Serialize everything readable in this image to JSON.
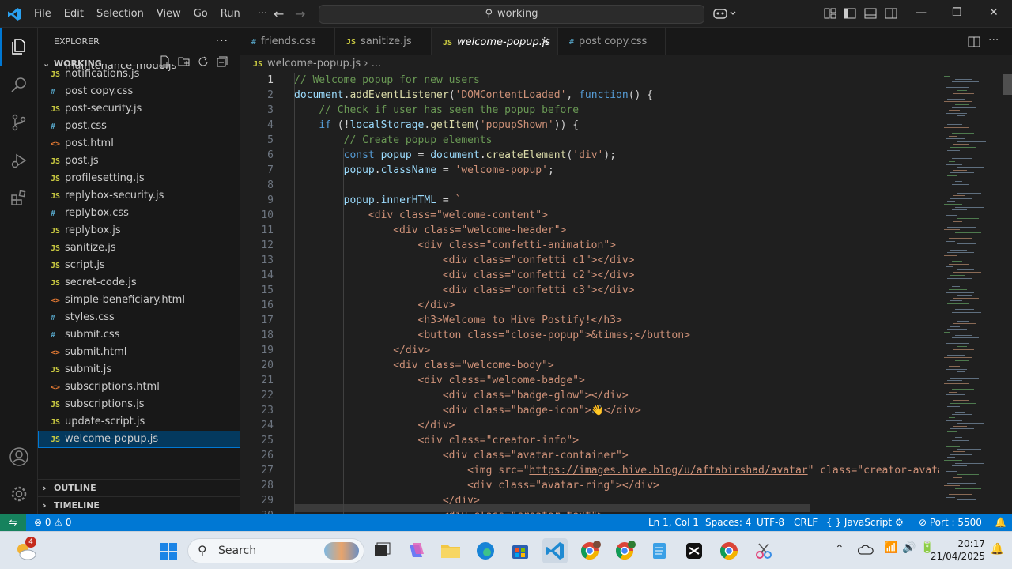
{
  "titlebar": {
    "menu": [
      "File",
      "Edit",
      "Selection",
      "View",
      "Go",
      "Run",
      "···"
    ],
    "search_text": "working",
    "colors": {
      "accent": "#0078d4",
      "background": "#1f1f1f"
    }
  },
  "activitybar": {
    "icons": [
      "explorer-icon",
      "search-icon",
      "source-control-icon",
      "run-debug-icon",
      "extensions-icon",
      "accounts-icon",
      "manage-gear-icon"
    ]
  },
  "sidebar": {
    "title": "EXPLORER",
    "folder": "WORKING",
    "partial_item": "maintenance-mode.js",
    "files": [
      {
        "name": "notifications.js",
        "type": "js"
      },
      {
        "name": "post copy.css",
        "type": "css"
      },
      {
        "name": "post-security.js",
        "type": "js"
      },
      {
        "name": "post.css",
        "type": "css"
      },
      {
        "name": "post.html",
        "type": "html"
      },
      {
        "name": "post.js",
        "type": "js"
      },
      {
        "name": "profilesetting.js",
        "type": "js"
      },
      {
        "name": "replybox-security.js",
        "type": "js"
      },
      {
        "name": "replybox.css",
        "type": "css"
      },
      {
        "name": "replybox.js",
        "type": "js"
      },
      {
        "name": "sanitize.js",
        "type": "js"
      },
      {
        "name": "script.js",
        "type": "js"
      },
      {
        "name": "secret-code.js",
        "type": "js"
      },
      {
        "name": "simple-beneficiary.html",
        "type": "html"
      },
      {
        "name": "styles.css",
        "type": "css"
      },
      {
        "name": "submit.css",
        "type": "css"
      },
      {
        "name": "submit.html",
        "type": "html"
      },
      {
        "name": "submit.js",
        "type": "js"
      },
      {
        "name": "subscriptions.html",
        "type": "html"
      },
      {
        "name": "subscriptions.js",
        "type": "js"
      },
      {
        "name": "update-script.js",
        "type": "js"
      },
      {
        "name": "welcome-popup.js",
        "type": "js",
        "selected": true
      }
    ],
    "outline": "OUTLINE",
    "timeline": "TIMELINE"
  },
  "tabs": [
    {
      "label": "friends.css",
      "type": "css",
      "icon": "#"
    },
    {
      "label": "sanitize.js",
      "type": "js",
      "icon": "JS"
    },
    {
      "label": "welcome-popup.js",
      "type": "js",
      "icon": "JS",
      "active": true
    },
    {
      "label": "post copy.css",
      "type": "css",
      "icon": "#"
    }
  ],
  "breadcrumb": {
    "file": "welcome-popup.js",
    "rest": "› ..."
  },
  "code_lines": [
    [
      [
        "c",
        "// Welcome popup for new users"
      ]
    ],
    [
      [
        "v",
        "document"
      ],
      [
        "p",
        "."
      ],
      [
        "f",
        "addEventListener"
      ],
      [
        "p",
        "("
      ],
      [
        "s",
        "'DOMContentLoaded'"
      ],
      [
        "p",
        ", "
      ],
      [
        "k",
        "function"
      ],
      [
        "p",
        "() {"
      ]
    ],
    [
      [
        "p",
        "    "
      ],
      [
        "c",
        "// Check if user has seen the popup before"
      ]
    ],
    [
      [
        "p",
        "    "
      ],
      [
        "k",
        "if"
      ],
      [
        "p",
        " (!"
      ],
      [
        "v",
        "localStorage"
      ],
      [
        "p",
        "."
      ],
      [
        "f",
        "getItem"
      ],
      [
        "p",
        "("
      ],
      [
        "s",
        "'popupShown'"
      ],
      [
        "p",
        ")) {"
      ]
    ],
    [
      [
        "p",
        "        "
      ],
      [
        "c",
        "// Create popup elements"
      ]
    ],
    [
      [
        "p",
        "        "
      ],
      [
        "k",
        "const"
      ],
      [
        "p",
        " "
      ],
      [
        "v",
        "popup"
      ],
      [
        "p",
        " = "
      ],
      [
        "v",
        "document"
      ],
      [
        "p",
        "."
      ],
      [
        "f",
        "createElement"
      ],
      [
        "p",
        "("
      ],
      [
        "s",
        "'div'"
      ],
      [
        "p",
        ");"
      ]
    ],
    [
      [
        "p",
        "        "
      ],
      [
        "v",
        "popup"
      ],
      [
        "p",
        "."
      ],
      [
        "v",
        "className"
      ],
      [
        "p",
        " = "
      ],
      [
        "s",
        "'welcome-popup'"
      ],
      [
        "p",
        ";"
      ]
    ],
    [
      [
        "p",
        ""
      ]
    ],
    [
      [
        "p",
        "        "
      ],
      [
        "v",
        "popup"
      ],
      [
        "p",
        "."
      ],
      [
        "v",
        "innerHTML"
      ],
      [
        "p",
        " = "
      ],
      [
        "s",
        "`"
      ]
    ],
    [
      [
        "s",
        "            <div class=\"welcome-content\">"
      ]
    ],
    [
      [
        "s",
        "                <div class=\"welcome-header\">"
      ]
    ],
    [
      [
        "s",
        "                    <div class=\"confetti-animation\">"
      ]
    ],
    [
      [
        "s",
        "                        <div class=\"confetti c1\"></div>"
      ]
    ],
    [
      [
        "s",
        "                        <div class=\"confetti c2\"></div>"
      ]
    ],
    [
      [
        "s",
        "                        <div class=\"confetti c3\"></div>"
      ]
    ],
    [
      [
        "s",
        "                    </div>"
      ]
    ],
    [
      [
        "s",
        "                    <h3>Welcome to Hive Postify!</h3>"
      ]
    ],
    [
      [
        "s",
        "                    <button class=\"close-popup\">&times;</button>"
      ]
    ],
    [
      [
        "s",
        "                </div>"
      ]
    ],
    [
      [
        "s",
        "                <div class=\"welcome-body\">"
      ]
    ],
    [
      [
        "s",
        "                    <div class=\"welcome-badge\">"
      ]
    ],
    [
      [
        "s",
        "                        <div class=\"badge-glow\"></div>"
      ]
    ],
    [
      [
        "s",
        "                        <div class=\"badge-icon\">"
      ],
      [
        "y",
        "👋"
      ],
      [
        "s",
        "</div>"
      ]
    ],
    [
      [
        "s",
        "                    </div>"
      ]
    ],
    [
      [
        "s",
        "                    <div class=\"creator-info\">"
      ]
    ],
    [
      [
        "s",
        "                        <div class=\"avatar-container\">"
      ]
    ],
    [
      [
        "s",
        "                            <img src=\""
      ],
      [
        "su",
        "https://images.hive.blog/u/aftabirshad/avatar"
      ],
      [
        "s",
        "\" class=\"creator-avatar"
      ]
    ],
    [
      [
        "s",
        "                            <div class=\"avatar-ring\"></div>"
      ]
    ],
    [
      [
        "s",
        "                        </div>"
      ]
    ],
    [
      [
        "s",
        "                        <div class=\"creator-text\">"
      ]
    ]
  ],
  "statusbar": {
    "problems": "⊗ 0 ⚠ 0",
    "position": "Ln 1, Col 1",
    "spaces": "Spaces: 4",
    "encoding": "UTF-8",
    "eol": "CRLF",
    "language": "{ } JavaScript",
    "port": "⊘ Port : 5500"
  },
  "taskbar": {
    "search": "Search",
    "weather_badge": "4",
    "time": "20:17",
    "date": "21/04/2025"
  }
}
